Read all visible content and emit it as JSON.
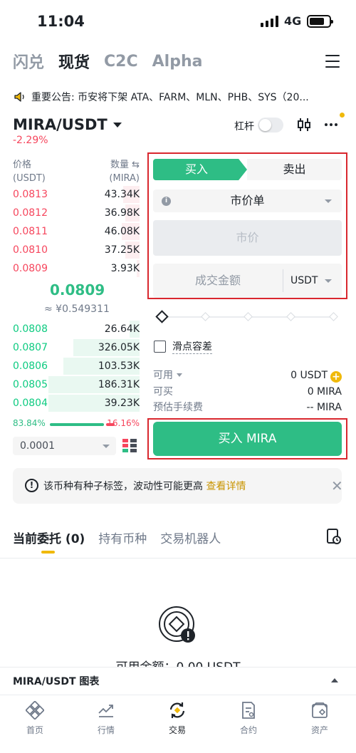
{
  "status_bar": {
    "time": "11:04",
    "network": "4G"
  },
  "top_tabs": [
    {
      "label": "闪兑",
      "active": false
    },
    {
      "label": "现货",
      "active": true
    },
    {
      "label": "C2C",
      "active": false
    },
    {
      "label": "Alpha",
      "active": false
    }
  ],
  "announcement": {
    "text": "重要公告: 币安将下架 ATA、FARM、MLN、PHB、SYS（20..."
  },
  "pair": {
    "symbol": "MIRA/USDT",
    "change": "-2.29%",
    "leverage_label": "杠杆",
    "leverage_on": false
  },
  "order_book": {
    "price_header": "价格",
    "price_unit": "(USDT)",
    "qty_header": "数量 ⇆",
    "qty_unit": "(MIRA)",
    "asks": [
      {
        "price": "0.0813",
        "qty": "43.34K",
        "depth": 0.13
      },
      {
        "price": "0.0812",
        "qty": "36.98K",
        "depth": 0.11
      },
      {
        "price": "0.0811",
        "qty": "46.08K",
        "depth": 0.14
      },
      {
        "price": "0.0810",
        "qty": "37.25K",
        "depth": 0.11
      },
      {
        "price": "0.0809",
        "qty": "3.93K",
        "depth": 0.02
      }
    ],
    "mid_price": "0.0809",
    "mid_cny": "≈ ¥0.549311",
    "bids": [
      {
        "price": "0.0808",
        "qty": "26.64K",
        "depth": 0.08
      },
      {
        "price": "0.0807",
        "qty": "326.05K",
        "depth": 0.52
      },
      {
        "price": "0.0806",
        "qty": "103.53K",
        "depth": 0.6
      },
      {
        "price": "0.0805",
        "qty": "186.31K",
        "depth": 0.72
      },
      {
        "price": "0.0804",
        "qty": "39.23K",
        "depth": 0.72
      }
    ],
    "buy_ratio": "83.84%",
    "sell_ratio": "16.16%",
    "precision": "0.0001"
  },
  "order_form": {
    "buy_tab": "买入",
    "sell_tab": "卖出",
    "order_type": "市价单",
    "price_placeholder": "市价",
    "amount_placeholder": "成交金额",
    "amount_unit": "USDT",
    "slippage_label": "滑点容差",
    "available_label": "可用",
    "available_value": "0 USDT",
    "can_buy_label": "可买",
    "can_buy_value": "0 MIRA",
    "fee_label": "预估手续费",
    "fee_value": "-- MIRA",
    "buy_button": "买入 MIRA"
  },
  "notice": {
    "text": "该币种有种子标签，波动性可能更高",
    "link": "查看详情"
  },
  "order_tabs": [
    {
      "label": "当前委托 (0)",
      "active": true
    },
    {
      "label": "持有币种",
      "active": false
    },
    {
      "label": "交易机器人",
      "active": false
    }
  ],
  "empty_state": {
    "text": "可用余额：0.00 USDT"
  },
  "chart_bar": {
    "label": "MIRA/USDT 图表"
  },
  "bottom_nav": [
    {
      "label": "首页",
      "icon": "home-icon",
      "active": false
    },
    {
      "label": "行情",
      "icon": "markets-icon",
      "active": false
    },
    {
      "label": "交易",
      "icon": "trade-icon",
      "active": true
    },
    {
      "label": "合约",
      "icon": "futures-icon",
      "active": false
    },
    {
      "label": "资产",
      "icon": "assets-icon",
      "active": false
    }
  ],
  "colors": {
    "buy": "#2ebd85",
    "sell": "#f6465d",
    "brand": "#f0b90b",
    "highlight": "#d9272e"
  }
}
